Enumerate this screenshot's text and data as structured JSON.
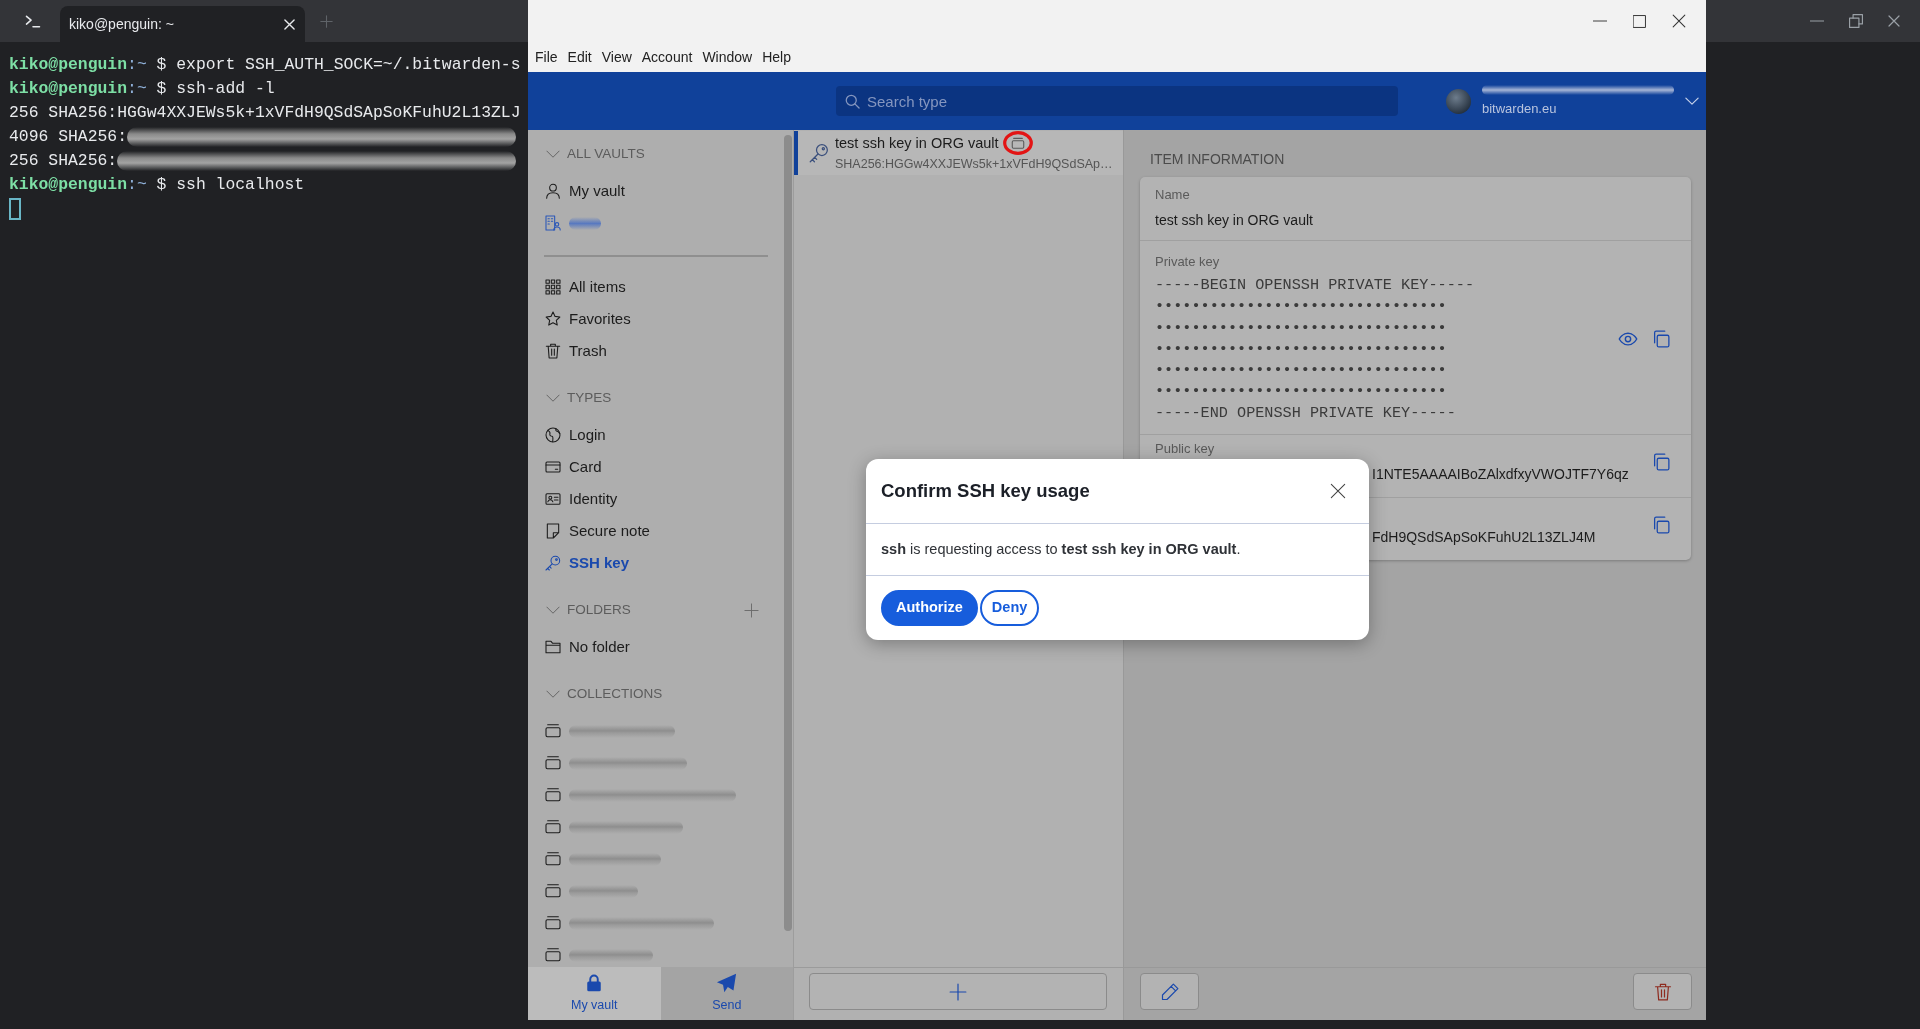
{
  "terminal": {
    "tabs": [
      {
        "title": "kiko@penguin: ~",
        "selected": true
      }
    ],
    "lines": [
      {
        "kind": "command",
        "user": "kiko@penguin",
        "path": ":~",
        "sign": "$",
        "text": "export SSH_AUTH_SOCK=~/.bitwarden-s"
      },
      {
        "kind": "command",
        "user": "kiko@penguin",
        "path": ":~",
        "sign": "$",
        "text": "ssh-add -l"
      },
      {
        "kind": "output",
        "text": "256 SHA256:HGGw4XXJEWs5k+1xVFdH9QSdSApSoKFuhU2L13ZLJ"
      },
      {
        "kind": "redacted",
        "text": "4096 SHA256:"
      },
      {
        "kind": "redacted",
        "text": "256 SHA256:"
      },
      {
        "kind": "command",
        "user": "kiko@penguin",
        "path": ":~",
        "sign": "$",
        "text": "ssh localhost"
      },
      {
        "kind": "cursor"
      }
    ]
  },
  "bitwarden": {
    "menu": [
      "File",
      "Edit",
      "View",
      "Account",
      "Window",
      "Help"
    ],
    "search": {
      "placeholder": "Search type"
    },
    "account": {
      "redacted_name": true,
      "server": "bitwarden.eu"
    },
    "sidebar": {
      "vaults": {
        "heading": "ALL VAULTS",
        "expanded": true,
        "items": [
          {
            "kind": "label",
            "label": "My vault",
            "selected": false
          },
          {
            "kind": "redacted",
            "selected": false
          }
        ]
      },
      "filters": [
        {
          "label": "All items",
          "selected": false
        },
        {
          "label": "Favorites",
          "selected": false
        },
        {
          "label": "Trash",
          "selected": false
        }
      ],
      "types": {
        "heading": "TYPES",
        "expanded": true,
        "items": [
          {
            "label": "Login",
            "selected": false
          },
          {
            "label": "Card",
            "selected": false
          },
          {
            "label": "Identity",
            "selected": false
          },
          {
            "label": "Secure note",
            "selected": false
          },
          {
            "label": "SSH key",
            "selected": true
          }
        ]
      },
      "folders": {
        "heading": "FOLDERS",
        "expanded": true,
        "items": [
          {
            "label": "No folder",
            "selected": false
          }
        ]
      },
      "collections": {
        "heading": "COLLECTIONS",
        "expanded": true,
        "items": [
          {
            "kind": "redacted",
            "selected": false
          },
          {
            "kind": "redacted",
            "selected": false
          },
          {
            "kind": "redacted",
            "selected": false
          },
          {
            "kind": "redacted",
            "selected": false
          },
          {
            "kind": "redacted",
            "selected": false
          },
          {
            "kind": "redacted",
            "selected": false
          },
          {
            "kind": "redacted",
            "selected": false
          },
          {
            "kind": "redacted",
            "selected": false
          }
        ]
      }
    },
    "bottom_nav": [
      {
        "label": "My vault",
        "selected": true
      },
      {
        "label": "Send",
        "selected": false
      }
    ],
    "item_list": {
      "items": [
        {
          "title": "test ssh key in ORG vault",
          "subtitle": "SHA256:HGGw4XXJEWs5k+1xVFdH9QSdSAp…",
          "selected": true,
          "shared": true,
          "circled": true
        }
      ]
    },
    "details": {
      "heading": "ITEM INFORMATION",
      "fields": [
        {
          "kind": "text",
          "label": "Name",
          "value": "test ssh key in ORG vault"
        },
        {
          "kind": "secret",
          "label": "Private key",
          "lines": [
            "-----BEGIN OPENSSH PRIVATE KEY-----",
            "••••••••••••••••••••••••••••••••",
            "••••••••••••••••••••••••••••••••",
            "••••••••••••••••••••••••••••••••",
            "••••••••••••••••••••••••••••••••",
            "••••••••••••••••••••••••••••••••",
            "-----END OPENSSH PRIVATE KEY-----"
          ]
        },
        {
          "kind": "obscured",
          "label": "Public key",
          "value": "I1NTE5AAAAIBoZAlxdfxyVWOJTF7Y6qz"
        },
        {
          "kind": "obscured",
          "value": "FdH9QSdSApSoKFuhU2L13ZLJ4M"
        }
      ]
    },
    "dialog": {
      "title": "Confirm SSH key usage",
      "message": "**ssh** is requesting access to **test ssh key in ORG vault**.",
      "buttons": [
        {
          "label": "Authorize",
          "kind": "primary"
        },
        {
          "label": "Deny",
          "kind": "secondary"
        }
      ]
    }
  }
}
